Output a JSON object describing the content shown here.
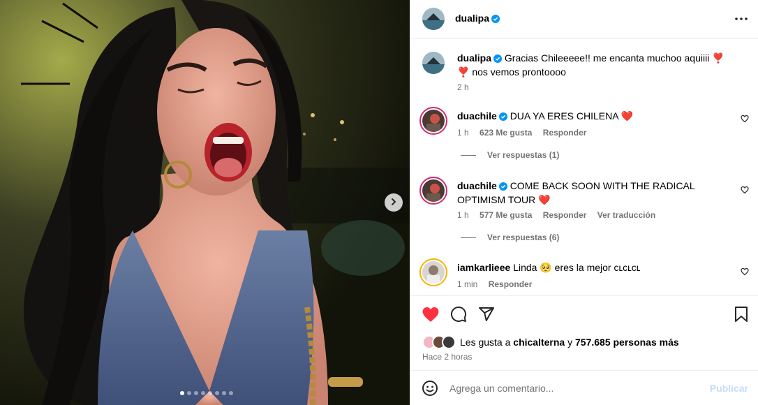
{
  "post": {
    "author": "dualipa",
    "more_icon": "more-horizontal-icon",
    "caption": "Gracias Chileeeee!! me encanta muchoo aquiiii ❣️ ❣️ nos vemos prontoooo",
    "caption_time": "2 h"
  },
  "media": {
    "slide_count": 8,
    "active_slide": 1,
    "next_icon": "chevron-right-icon"
  },
  "comments": [
    {
      "user": "duachile",
      "verified": true,
      "text": "DUA YA ERES CHILENA ❤️",
      "time": "1 h",
      "likes": "623 Me gusta",
      "reply": "Responder",
      "replies_label": "Ver respuestas (1)"
    },
    {
      "user": "duachile",
      "verified": true,
      "text": "COME BACK SOON WITH THE RADICAL OPTIMISM TOUR ❤️",
      "time": "1 h",
      "likes": "577 Me gusta",
      "reply": "Responder",
      "translate": "Ver traducción",
      "replies_label": "Ver respuestas (6)"
    },
    {
      "user": "iamkarlieee",
      "verified": false,
      "text": "Linda 🥺 eres la mejor ᴄʟᴄʟᴄʟ",
      "time": "1 min",
      "reply": "Responder"
    }
  ],
  "actions": {
    "like_icon": "heart-filled-icon",
    "comment_icon": "comment-icon",
    "share_icon": "share-icon",
    "save_icon": "bookmark-icon",
    "like_color": "#ff3040",
    "likes_prefix": "Les gusta a",
    "likes_user": "chicalterna",
    "likes_joiner": "y",
    "likes_count": "757.685 personas más",
    "posted": "Hace 2 horas"
  },
  "comment_box": {
    "emoji_icon": "emoji-icon",
    "placeholder": "Agrega un comentario...",
    "publish_label": "Publicar"
  },
  "colors": {
    "verified": "#0095f6",
    "secondary_text": "#737373",
    "publish_disabled": "#c4dcf8"
  }
}
